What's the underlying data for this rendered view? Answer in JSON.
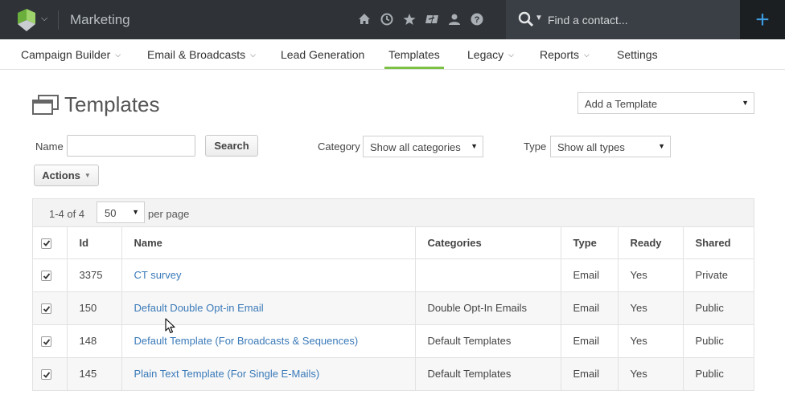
{
  "topbar": {
    "app_name": "Marketing",
    "search_placeholder": "Find a contact...",
    "icons": [
      "home-icon",
      "clock-icon",
      "star-icon",
      "puzzle-icon",
      "user-icon",
      "help-icon"
    ],
    "add_label": "+"
  },
  "nav": {
    "items": [
      {
        "label": "Campaign Builder",
        "dropdown": true
      },
      {
        "label": "Email & Broadcasts",
        "dropdown": true
      },
      {
        "label": "Lead Generation",
        "dropdown": false
      },
      {
        "label": "Templates",
        "dropdown": false,
        "active": true
      },
      {
        "label": "Legacy",
        "dropdown": true
      },
      {
        "label": "Reports",
        "dropdown": true
      },
      {
        "label": "Settings",
        "dropdown": false
      }
    ]
  },
  "page": {
    "title": "Templates",
    "add_template": "Add a Template"
  },
  "filters": {
    "name_label": "Name",
    "name_value": "",
    "search_button": "Search",
    "category_label": "Category",
    "category_value": "Show all categories",
    "type_label": "Type",
    "type_value": "Show all types",
    "actions_button": "Actions"
  },
  "pager": {
    "count": "1-4 of 4",
    "per_page_value": "50",
    "per_page_label": "per page"
  },
  "table": {
    "columns": [
      "Id",
      "Name",
      "Categories",
      "Type",
      "Ready",
      "Shared"
    ],
    "rows": [
      {
        "id": "3375",
        "name": "CT survey",
        "categories": "",
        "type": "Email",
        "ready": "Yes",
        "shared": "Private"
      },
      {
        "id": "150",
        "name": "Default Double Opt-in Email",
        "categories": "Double Opt-In Emails",
        "type": "Email",
        "ready": "Yes",
        "shared": "Public"
      },
      {
        "id": "148",
        "name": "Default Template (For Broadcasts & Sequences)",
        "categories": "Default Templates",
        "type": "Email",
        "ready": "Yes",
        "shared": "Public"
      },
      {
        "id": "145",
        "name": "Plain Text Template (For Single E-Mails)",
        "categories": "Default Templates",
        "type": "Email",
        "ready": "Yes",
        "shared": "Public"
      }
    ]
  },
  "colors": {
    "topbar": "#2f3338",
    "accent_green": "#7bc143",
    "link_blue": "#3a7ab9",
    "add_blue": "#3d9be0"
  }
}
